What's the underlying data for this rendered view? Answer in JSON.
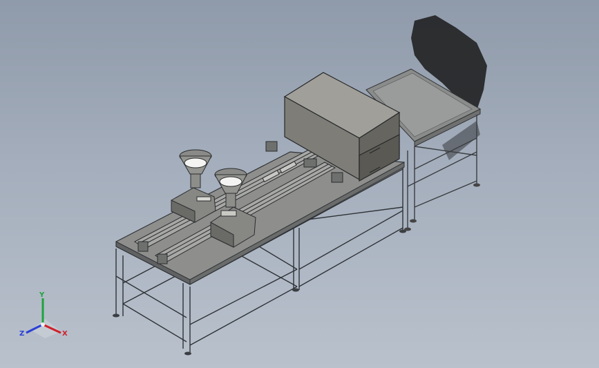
{
  "viewport": {
    "background_top": "#8f9aaa",
    "background_bottom": "#b9c1cc"
  },
  "model": {
    "description_icons": [
      "frame-icon",
      "conveyor-icon",
      "hopper-icon",
      "oven-box-icon",
      "shadow-icon"
    ]
  },
  "triad": {
    "x_label": "X",
    "y_label": "Y",
    "z_label": "Z",
    "x_color": "#d0202a",
    "y_color": "#1da33a",
    "z_color": "#2a3fd6"
  }
}
